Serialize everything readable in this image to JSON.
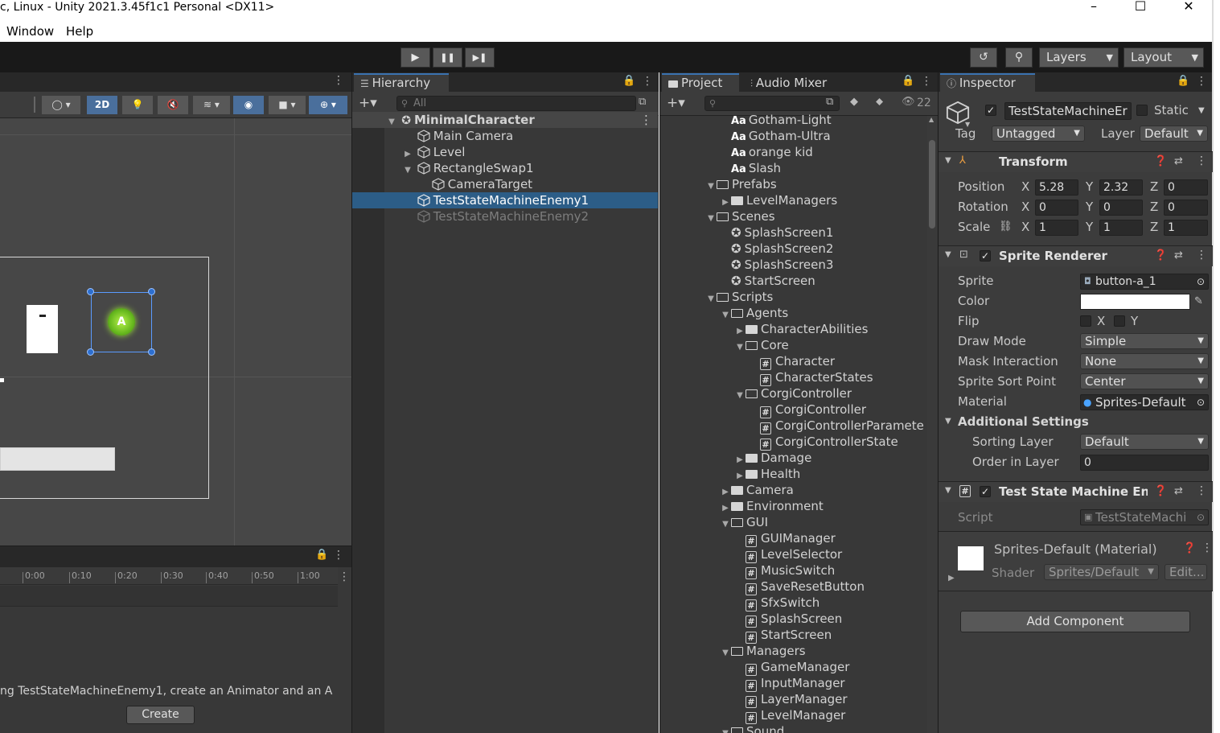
{
  "window": {
    "title": "c, Linux - Unity 2021.3.45f1c1 Personal <DX11>",
    "minimize": "–",
    "maximize": "☐",
    "close": "✕"
  },
  "menu": {
    "window": "Window",
    "help": "Help"
  },
  "toolbar": {
    "play": "▶",
    "pause": "❚❚",
    "step": "▶❚",
    "history": "↺",
    "search": "⚲",
    "layers": "Layers",
    "layout": "Layout"
  },
  "scene": {
    "mode_2d": "2D"
  },
  "animation": {
    "ticks": [
      "0:00",
      "0:10",
      "0:20",
      "0:30",
      "0:40",
      "0:50",
      "1:00"
    ],
    "message": "ng TestStateMachineEnemy1, create an Animator and an A",
    "create": "Create"
  },
  "hierarchy": {
    "tab": "Hierarchy",
    "search_placeholder": "All",
    "items": [
      {
        "label": "MinimalCharacter",
        "level": 0,
        "expanded": true
      },
      {
        "label": "Main Camera",
        "level": 1
      },
      {
        "label": "Level",
        "level": 1,
        "collapsed": true
      },
      {
        "label": "RectangleSwap1",
        "level": 1,
        "expanded": true
      },
      {
        "label": "CameraTarget",
        "level": 2
      },
      {
        "label": "TestStateMachineEnemy1",
        "level": 1,
        "selected": true
      },
      {
        "label": "TestStateMachineEnemy2",
        "level": 1,
        "disabled": true
      }
    ]
  },
  "project": {
    "tab": "Project",
    "tab2": "Audio Mixer",
    "hidden_count": "22",
    "items": [
      {
        "label": "Gotham-Light",
        "level": 0,
        "type": "font"
      },
      {
        "label": "Gotham-Ultra",
        "level": 0,
        "type": "font"
      },
      {
        "label": "orange kid",
        "level": 0,
        "type": "font"
      },
      {
        "label": "Slash",
        "level": 0,
        "type": "font"
      },
      {
        "label": "Prefabs",
        "level": -1,
        "type": "folder-open"
      },
      {
        "label": "LevelManagers",
        "level": 0,
        "type": "folder"
      },
      {
        "label": "Scenes",
        "level": -1,
        "type": "folder-open"
      },
      {
        "label": "SplashScreen1",
        "level": 0,
        "type": "scene"
      },
      {
        "label": "SplashScreen2",
        "level": 0,
        "type": "scene"
      },
      {
        "label": "SplashScreen3",
        "level": 0,
        "type": "scene"
      },
      {
        "label": "StartScreen",
        "level": 0,
        "type": "scene"
      },
      {
        "label": "Scripts",
        "level": -1,
        "type": "folder-open"
      },
      {
        "label": "Agents",
        "level": 0,
        "type": "folder-open"
      },
      {
        "label": "CharacterAbilities",
        "level": 1,
        "type": "folder"
      },
      {
        "label": "Core",
        "level": 1,
        "type": "folder-open"
      },
      {
        "label": "Character",
        "level": 2,
        "type": "script"
      },
      {
        "label": "CharacterStates",
        "level": 2,
        "type": "script"
      },
      {
        "label": "CorgiController",
        "level": 1,
        "type": "folder-open"
      },
      {
        "label": "CorgiController",
        "level": 2,
        "type": "script"
      },
      {
        "label": "CorgiControllerParamete",
        "level": 2,
        "type": "script"
      },
      {
        "label": "CorgiControllerState",
        "level": 2,
        "type": "script"
      },
      {
        "label": "Damage",
        "level": 1,
        "type": "folder"
      },
      {
        "label": "Health",
        "level": 1,
        "type": "folder"
      },
      {
        "label": "Camera",
        "level": 0,
        "type": "folder"
      },
      {
        "label": "Environment",
        "level": 0,
        "type": "folder"
      },
      {
        "label": "GUI",
        "level": 0,
        "type": "folder-open"
      },
      {
        "label": "GUIManager",
        "level": 1,
        "type": "script"
      },
      {
        "label": "LevelSelector",
        "level": 1,
        "type": "script"
      },
      {
        "label": "MusicSwitch",
        "level": 1,
        "type": "script"
      },
      {
        "label": "SaveResetButton",
        "level": 1,
        "type": "script"
      },
      {
        "label": "SfxSwitch",
        "level": 1,
        "type": "script"
      },
      {
        "label": "SplashScreen",
        "level": 1,
        "type": "script"
      },
      {
        "label": "StartScreen",
        "level": 1,
        "type": "script"
      },
      {
        "label": "Managers",
        "level": 0,
        "type": "folder-open"
      },
      {
        "label": "GameManager",
        "level": 1,
        "type": "script"
      },
      {
        "label": "InputManager",
        "level": 1,
        "type": "script"
      },
      {
        "label": "LayerManager",
        "level": 1,
        "type": "script"
      },
      {
        "label": "LevelManager",
        "level": 1,
        "type": "script"
      },
      {
        "label": "Sound",
        "level": 0,
        "type": "folder-open"
      }
    ]
  },
  "inspector": {
    "tab": "Inspector",
    "object_name": "TestStateMachineEr",
    "static": "Static",
    "tag_label": "Tag",
    "tag": "Untagged",
    "layer_label": "Layer",
    "layer": "Default",
    "transform": {
      "title": "Transform",
      "position_label": "Position",
      "rotation_label": "Rotation",
      "scale_label": "Scale",
      "position": {
        "x": "5.28",
        "y": "2.32",
        "z": "0"
      },
      "rotation": {
        "x": "0",
        "y": "0",
        "z": "0"
      },
      "scale": {
        "x": "1",
        "y": "1",
        "z": "1"
      },
      "axis_x": "X",
      "axis_y": "Y",
      "axis_z": "Z"
    },
    "sprite_renderer": {
      "title": "Sprite Renderer",
      "sprite_label": "Sprite",
      "sprite": "button-a_1",
      "color_label": "Color",
      "flip_label": "Flip",
      "flip_x": "X",
      "flip_y": "Y",
      "draw_mode_label": "Draw Mode",
      "draw_mode": "Simple",
      "mask_label": "Mask Interaction",
      "mask": "None",
      "sort_point_label": "Sprite Sort Point",
      "sort_point": "Center",
      "material_label": "Material",
      "material": "Sprites-Default",
      "additional": "Additional Settings",
      "sorting_layer_label": "Sorting Layer",
      "sorting_layer": "Default",
      "order_label": "Order in Layer",
      "order": "0"
    },
    "script_comp": {
      "title": "Test State Machine Enen",
      "script_label": "Script",
      "script": "TestStateMachi"
    },
    "material": {
      "name": "Sprites-Default (Material)",
      "shader_label": "Shader",
      "shader": "Sprites/Default",
      "edit": "Edit..."
    },
    "add_component": "Add Component"
  }
}
